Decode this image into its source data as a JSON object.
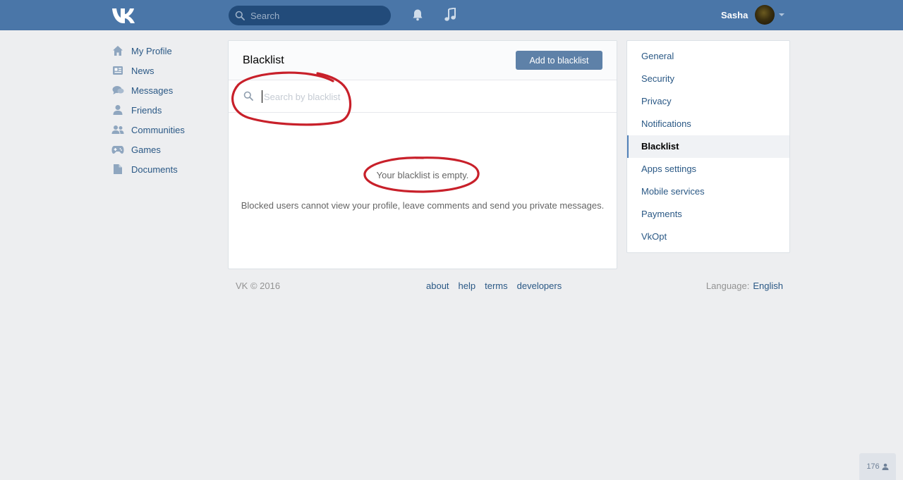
{
  "header": {
    "search_placeholder": "Search",
    "user_name": "Sasha"
  },
  "left_nav": [
    {
      "label": "My Profile",
      "icon": "home-icon"
    },
    {
      "label": "News",
      "icon": "news-icon"
    },
    {
      "label": "Messages",
      "icon": "messages-icon"
    },
    {
      "label": "Friends",
      "icon": "friends-icon"
    },
    {
      "label": "Communities",
      "icon": "communities-icon"
    },
    {
      "label": "Games",
      "icon": "games-icon"
    },
    {
      "label": "Documents",
      "icon": "documents-icon"
    }
  ],
  "main": {
    "title": "Blacklist",
    "add_button": "Add to blacklist",
    "search_placeholder": "Search by blacklist",
    "empty_title": "Your blacklist is empty.",
    "empty_desc": "Blocked users cannot view your profile, leave comments and send you private messages."
  },
  "settings_menu": [
    {
      "label": "General"
    },
    {
      "label": "Security"
    },
    {
      "label": "Privacy"
    },
    {
      "label": "Notifications"
    },
    {
      "label": "Blacklist",
      "active": true
    },
    {
      "label": "Apps settings"
    },
    {
      "label": "Mobile services"
    },
    {
      "label": "Payments"
    },
    {
      "label": "VkOpt"
    }
  ],
  "footer": {
    "copyright": "VK © 2016",
    "links": [
      "about",
      "help",
      "terms",
      "developers"
    ],
    "language_label": "Language:",
    "language_value": "English"
  },
  "online_count": "176",
  "colors": {
    "header": "#4a76a8",
    "link": "#2a5885",
    "button": "#5e81a8",
    "annotation": "#c8202a"
  }
}
